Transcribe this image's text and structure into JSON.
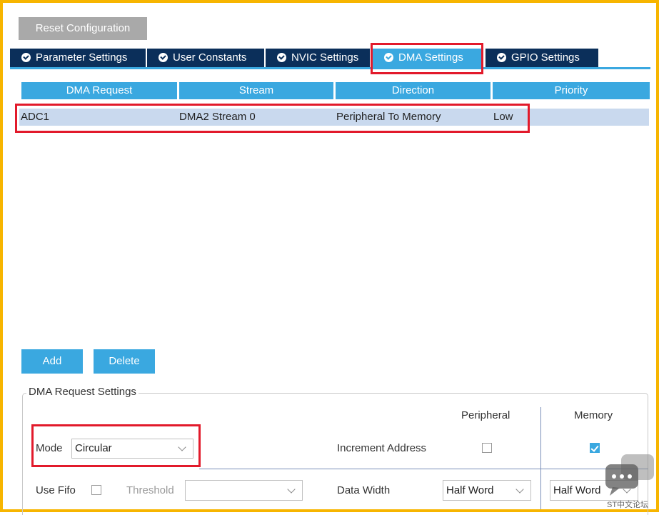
{
  "toolbar": {
    "reset_label": "Reset Configuration"
  },
  "tabs": [
    {
      "label": "Parameter Settings",
      "active": false
    },
    {
      "label": "User Constants",
      "active": false
    },
    {
      "label": "NVIC Settings",
      "active": false
    },
    {
      "label": "DMA Settings",
      "active": true
    },
    {
      "label": "GPIO Settings",
      "active": false
    }
  ],
  "table": {
    "headers": [
      "DMA Request",
      "Stream",
      "Direction",
      "Priority"
    ],
    "rows": [
      {
        "request": "ADC1",
        "stream": "DMA2 Stream 0",
        "direction": "Peripheral To Memory",
        "priority": "Low"
      }
    ]
  },
  "actions": {
    "add_label": "Add",
    "delete_label": "Delete"
  },
  "settings": {
    "group_title": "DMA Request Settings",
    "col_peripheral": "Peripheral",
    "col_memory": "Memory",
    "mode_label": "Mode",
    "mode_value": "Circular",
    "increment_label": "Increment Address",
    "increment_peripheral": false,
    "increment_memory": true,
    "fifo_label": "Use Fifo",
    "fifo_checked": false,
    "threshold_label": "Threshold",
    "threshold_value": "",
    "data_width_label": "Data Width",
    "data_width_peripheral": "Half Word",
    "data_width_memory": "Half Word"
  },
  "watermark": {
    "text": "ST中文论坛",
    "icon": "chat-bubble-icon"
  },
  "colors": {
    "accent": "#3aa8e0",
    "tab_dark": "#0b2f5a",
    "highlight": "#e21a2b",
    "frame": "#f7b500",
    "row_selected": "#c9d9ee"
  }
}
